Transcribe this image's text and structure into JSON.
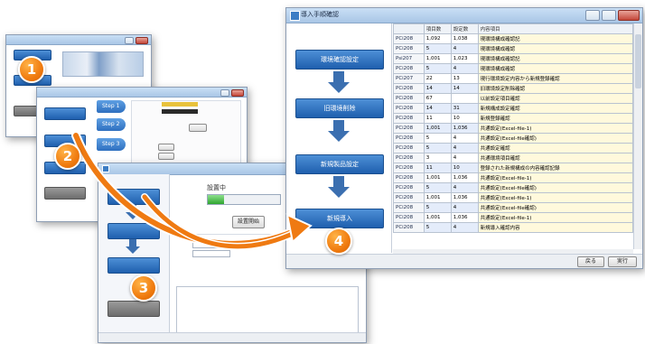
{
  "step_badges": [
    "1",
    "2",
    "3",
    "4"
  ],
  "window1": {
    "title": ""
  },
  "window2": {
    "title": "",
    "steps": [
      "Step 1",
      "Step 2",
      "Step 3"
    ]
  },
  "window3": {
    "title": "",
    "label": "設置中",
    "button": "設置開始"
  },
  "window4": {
    "title": "導入手順確認",
    "flow": [
      "環境確認設定",
      "旧環境削除",
      "新規製品設定",
      "新規導入"
    ],
    "table": {
      "headers": [
        "",
        "項目数",
        "設定数",
        "内容項目"
      ],
      "rows": [
        [
          "PCi208",
          "1,092",
          "1,038",
          "現環境構成確認記"
        ],
        [
          "PCi208",
          "5",
          "4",
          "現環境構成確認"
        ],
        [
          "Psi207",
          "1,001",
          "1,023",
          "現環境構成確認記"
        ],
        [
          "PCi208",
          "5",
          "4",
          "現環境構成確認"
        ],
        [
          "PCi207",
          "22",
          "13",
          "現行環境設定内容から新規登録確認"
        ],
        [
          "PCi208",
          "14",
          "14",
          "旧環境設定削除確認"
        ],
        [
          "PCi208",
          "67",
          "",
          "以前設定項目確認"
        ],
        [
          "PCi208",
          "14",
          "31",
          "新規構成設定確認"
        ],
        [
          "PCi208",
          "11",
          "10",
          "新規登録確認"
        ],
        [
          "PCi208",
          "1,001",
          "1,036",
          "共通設定(Excel-file-1)"
        ],
        [
          "PCi208",
          "5",
          "4",
          "共通設定(Excel-file確認)"
        ],
        [
          "PCi208",
          "5",
          "4",
          "共通設定確認"
        ],
        [
          "PCi208",
          "3",
          "4",
          "共通環境項目確認"
        ],
        [
          "PCi208",
          "11",
          "10",
          "登録された新規構成の内容確認記録"
        ],
        [
          "PCi208",
          "1,001",
          "1,036",
          "共通設定(Excel-file-1)"
        ],
        [
          "PCi208",
          "5",
          "4",
          "共通設定(Excel-file確認)"
        ],
        [
          "PCi208",
          "1,001",
          "1,036",
          "共通設定(Excel-file-1)"
        ],
        [
          "PCi208",
          "5",
          "4",
          "共通設定(Excel-file確認)"
        ],
        [
          "PCi208",
          "1,001",
          "1,036",
          "共通設定(Excel-file-1)"
        ],
        [
          "PCi208",
          "5",
          "4",
          "新規導入確認内容"
        ]
      ]
    },
    "footer_buttons": [
      "戻る",
      "実行"
    ]
  },
  "colors": {
    "accent": "#2e6fbf",
    "badge": "#f07c10",
    "arrow": "#ef7a12"
  }
}
